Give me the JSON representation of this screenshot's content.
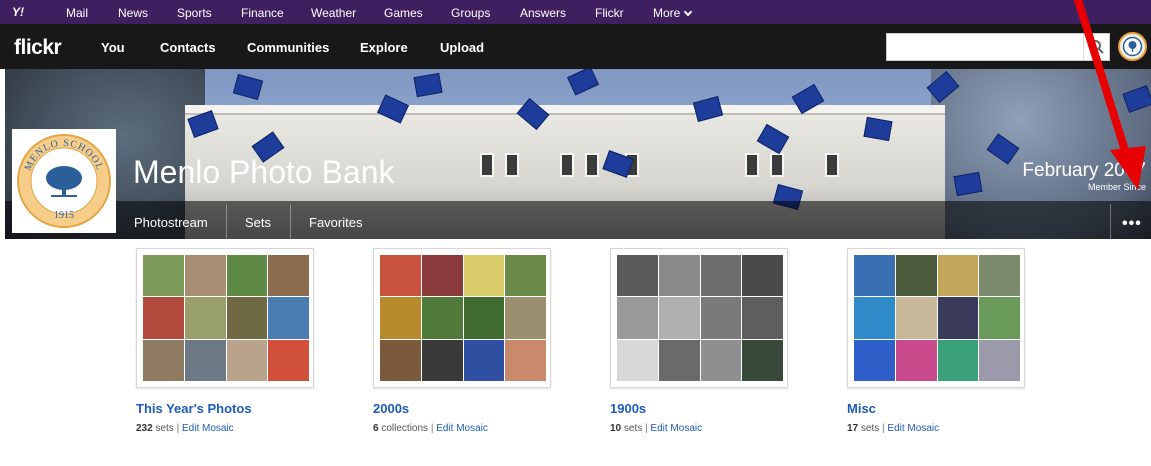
{
  "yahoo_bar": {
    "logo": "Y!",
    "links": [
      "Mail",
      "News",
      "Sports",
      "Finance",
      "Weather",
      "Games",
      "Groups",
      "Answers",
      "Flickr",
      "More"
    ]
  },
  "flickr_bar": {
    "logo": "flickr",
    "nav": [
      "You",
      "Contacts",
      "Communities",
      "Explore",
      "Upload"
    ],
    "search": {
      "value": "",
      "placeholder": ""
    }
  },
  "profile": {
    "name": "Menlo Photo Bank",
    "logo_text": [
      "MENLO SCHOOL",
      "1915"
    ],
    "member_since_date": "February 2007",
    "member_since_label": "Member Since",
    "tabs": [
      "Photostream",
      "Sets",
      "Favorites"
    ],
    "more": "•••"
  },
  "colors": {
    "yahoo_purple": "#3f1f5f",
    "flickr_black": "#181818",
    "link_blue": "#1e5bb7",
    "arrow_red": "#e60000"
  },
  "albums": [
    {
      "title": "This Year's Photos",
      "count": "232",
      "unit": "sets",
      "sep": "|",
      "edit": "Edit Mosaic"
    },
    {
      "title": "2000s",
      "count": "6",
      "unit": "collections",
      "sep": "|",
      "edit": "Edit Mosaic"
    },
    {
      "title": "1900s",
      "count": "10",
      "unit": "sets",
      "sep": "|",
      "edit": "Edit Mosaic"
    },
    {
      "title": "Misc",
      "count": "17",
      "unit": "sets",
      "sep": "|",
      "edit": "Edit Mosaic"
    }
  ]
}
